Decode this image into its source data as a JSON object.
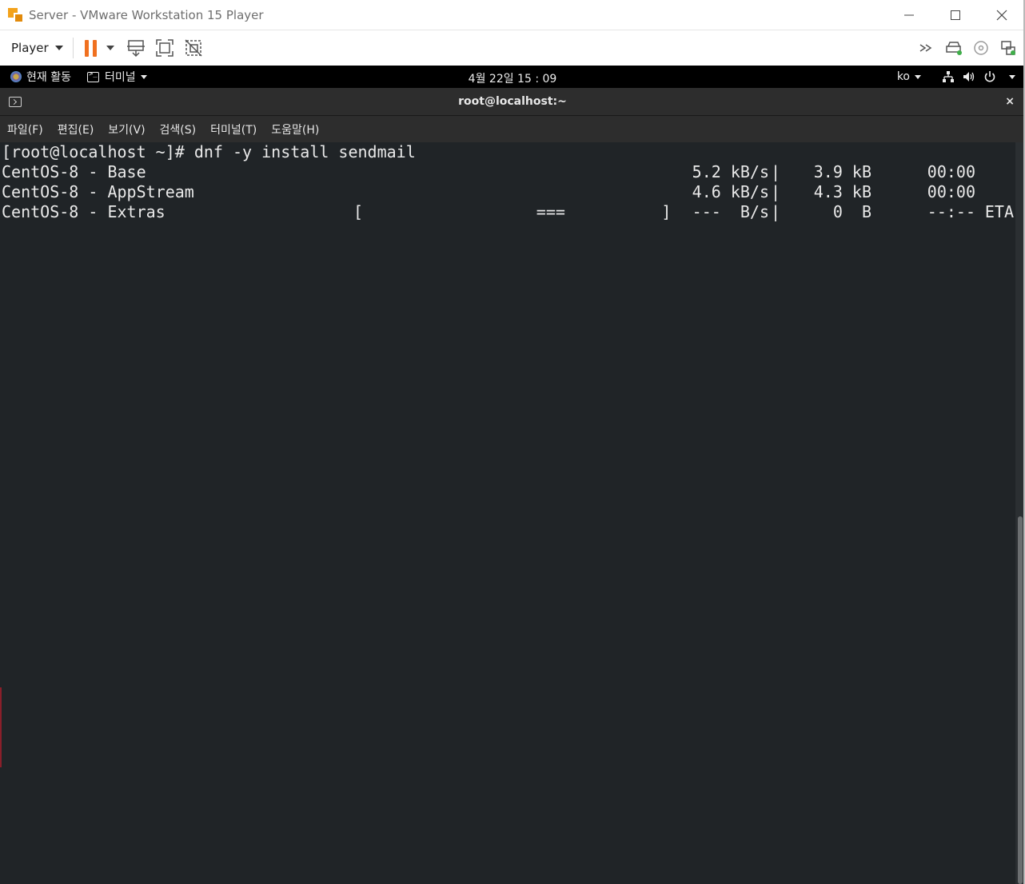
{
  "window": {
    "title": "Server - VMware Workstation 15 Player"
  },
  "toolbar": {
    "player_label": "Player",
    "icons": [
      "pause-icon",
      "send-ctrl-alt-del-icon",
      "fullscreen-icon",
      "unity-icon",
      "forward-icon",
      "hard-disk-icon",
      "cd-rom-icon",
      "network-adapter-icon"
    ]
  },
  "gnome": {
    "activities": "현재 활동",
    "app_menu": "터미널",
    "clock": "4월 22일 15 : 09",
    "lang": "ko"
  },
  "terminal": {
    "title": "root@localhost:~",
    "close": "×",
    "menu": [
      "파일(F)",
      "편집(E)",
      "보기(V)",
      "검색(S)",
      "터미널(T)",
      "도움말(H)"
    ],
    "prompt": "[root@localhost ~]# dnf -y install sendmail",
    "repos": [
      {
        "name": "CentOS-8 - Base",
        "bar": "",
        "rate": "5.2 kB/s",
        "sep": "|",
        "size": "3.9 kB",
        "eta": "00:00",
        "eta_label": ""
      },
      {
        "name": "CentOS-8 - AppStream",
        "bar": "",
        "rate": "4.6 kB/s",
        "sep": "|",
        "size": "4.3 kB",
        "eta": "00:00",
        "eta_label": ""
      },
      {
        "name": "CentOS-8 - Extras",
        "bar": "[                  ===          ]",
        "rate": "---  B/s",
        "sep": "|",
        "size": "0  B",
        "eta": "--:--",
        "eta_label": "ETA"
      }
    ]
  },
  "colors": {
    "terminal_bg": "#202427",
    "terminal_fg": "#e9e9e9",
    "pause_accent": "#f0701f"
  }
}
